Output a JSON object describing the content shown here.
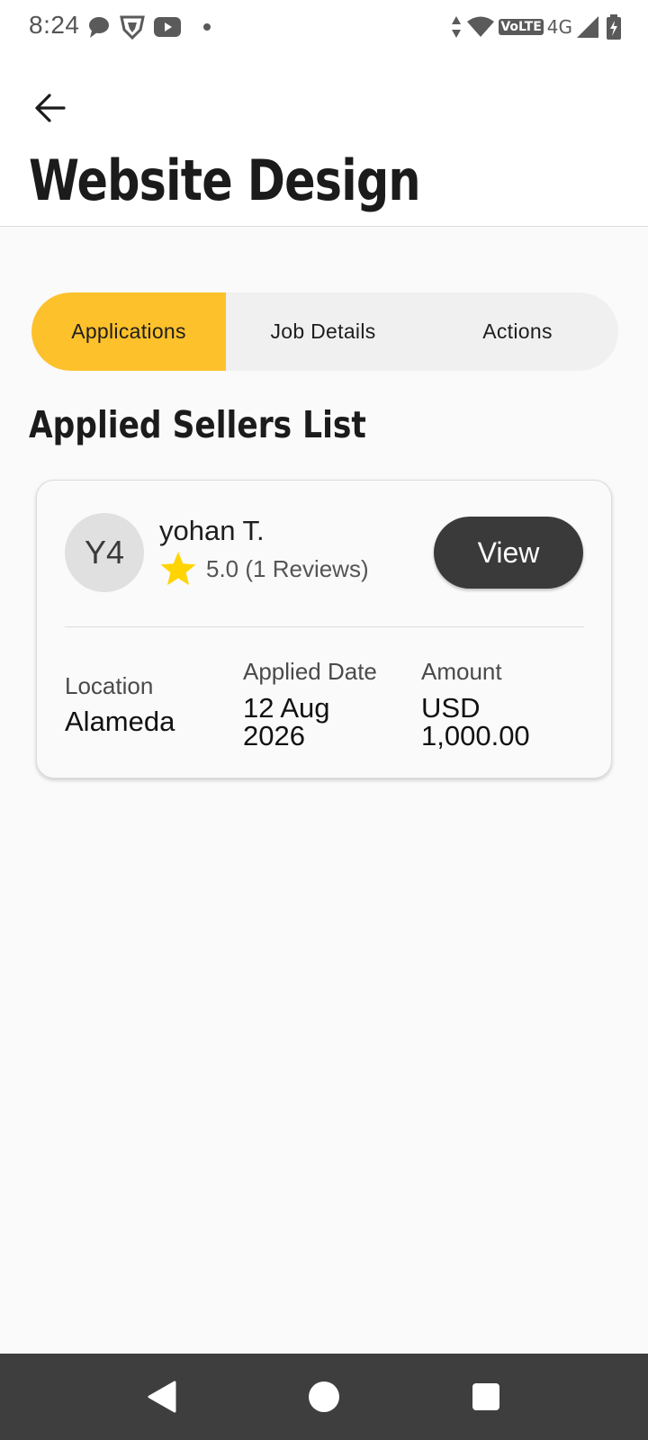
{
  "status_bar": {
    "time": "8:24",
    "volte": "VoLTE",
    "network": "4G",
    "icons": [
      "chat-bubble-icon",
      "shield-icon",
      "youtube-icon",
      "dot-icon",
      "data-arrows-icon",
      "wifi-icon",
      "signal-icon",
      "battery-charging-icon"
    ]
  },
  "header": {
    "back_icon": "arrow-left-icon",
    "title": "Website Design"
  },
  "tabs": [
    {
      "label": "Applications",
      "active": true
    },
    {
      "label": "Job Details",
      "active": false
    },
    {
      "label": "Actions",
      "active": false
    }
  ],
  "section_title": "Applied Sellers List",
  "seller": {
    "avatar_initials": "Y4",
    "name": "yohan T.",
    "rating": "5.0 (1 Reviews)",
    "star_icon": "star-icon",
    "view_label": "View",
    "location_label": "Location",
    "location_value": "Alameda",
    "applied_date_label": "Applied Date",
    "applied_date_line1": "12 Aug",
    "applied_date_line2": "2026",
    "amount_label": "Amount",
    "amount_line1": "USD",
    "amount_line2": "1,000.00"
  },
  "colors": {
    "accent": "#fdc12b",
    "button_dark": "#3a3a3a",
    "star": "#ffd400",
    "nav_bar": "#3e3e3e"
  },
  "nav_bar": {
    "icons": [
      "back-triangle-icon",
      "home-circle-icon",
      "recents-square-icon"
    ]
  }
}
